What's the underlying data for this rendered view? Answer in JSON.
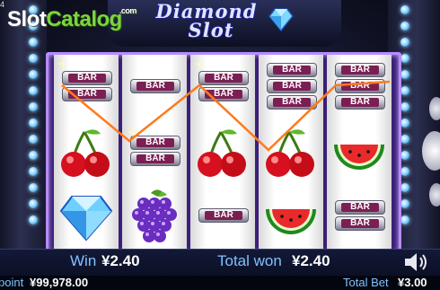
{
  "game": {
    "title_line1": "Diamond",
    "title_line2": "Slot",
    "corner_number": "4"
  },
  "watermark": {
    "brand_a": "Slot",
    "brand_b": "Catalog",
    "brand_suffix": ".com"
  },
  "symbols": {
    "bar_text": "BAR"
  },
  "reels": [
    [
      "double-bar",
      "cherry",
      "diamond"
    ],
    [
      "single-bar",
      "double-bar",
      "grapes"
    ],
    [
      "double-bar",
      "cherry",
      "single-bar"
    ],
    [
      "triple-bar",
      "cherry",
      "watermelon"
    ],
    [
      "triple-bar",
      "watermelon",
      "double-bar"
    ]
  ],
  "win_line": {
    "color": "#ff7a1a"
  },
  "info": {
    "win_label": "Win",
    "win_value": "¥2.40",
    "total_won_label": "Total won",
    "total_won_value": "¥2.40",
    "point_label": "point",
    "point_value": "¥99,978.00",
    "total_bet_label": "Total Bet",
    "total_bet_value": "¥3.00"
  },
  "colors": {
    "frame_accent": "#b58cff",
    "label_blue": "#7fc1ff"
  }
}
